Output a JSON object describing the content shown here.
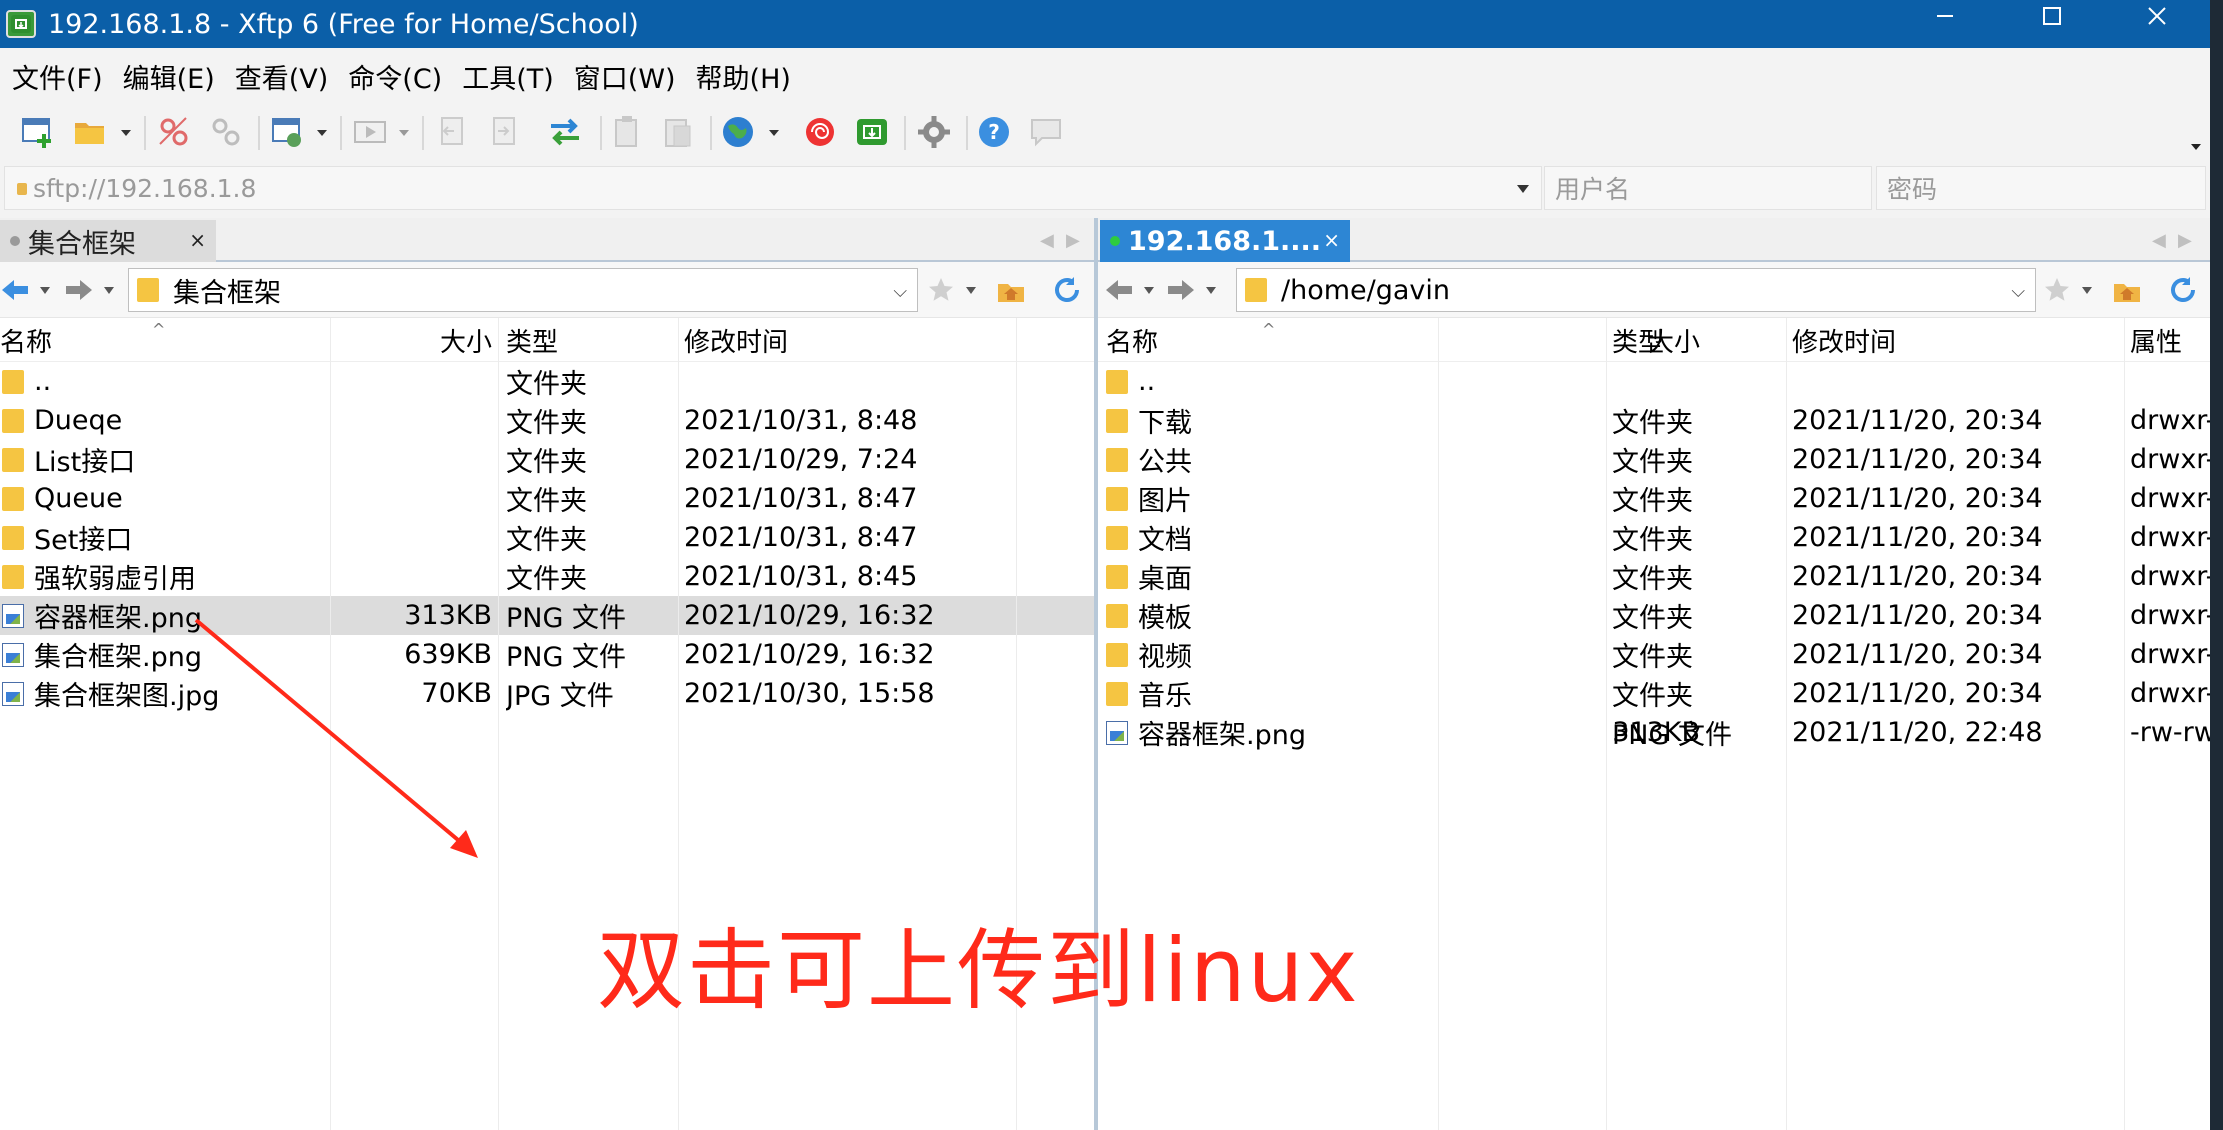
{
  "window": {
    "title": "192.168.1.8 - Xftp 6 (Free for Home/School)",
    "app_icon_label": "🔄"
  },
  "menu": [
    "文件(F)",
    "编辑(E)",
    "查看(V)",
    "命令(C)",
    "工具(T)",
    "窗口(W)",
    "帮助(H)"
  ],
  "toolbar": {
    "icons": [
      "new-session-icon",
      "open-folder-icon",
      "disconnect-icon",
      "reconnect-icon",
      "properties-icon",
      "play-icon",
      "copy-left-icon",
      "copy-right-icon",
      "transfer-icon",
      "paste-icon",
      "paste2-icon",
      "globe-icon",
      "xshell-icon",
      "xftp-icon",
      "gear-icon",
      "help-icon",
      "chat-icon"
    ]
  },
  "address": {
    "value": "sftp://192.168.1.8",
    "user_placeholder": "用户名",
    "password_placeholder": "密码"
  },
  "left_pane": {
    "tab_label": "集合框架",
    "path": "集合框架",
    "columns": [
      "名称",
      "大小",
      "类型",
      "修改时间"
    ],
    "rows": [
      {
        "name": "..",
        "size": "",
        "type": "文件夹",
        "modified": "",
        "icon": "folder"
      },
      {
        "name": "Dueqe",
        "size": "",
        "type": "文件夹",
        "modified": "2021/10/31, 8:48",
        "icon": "folder"
      },
      {
        "name": "List接口",
        "size": "",
        "type": "文件夹",
        "modified": "2021/10/29, 7:24",
        "icon": "folder"
      },
      {
        "name": "Queue",
        "size": "",
        "type": "文件夹",
        "modified": "2021/10/31, 8:47",
        "icon": "folder"
      },
      {
        "name": "Set接口",
        "size": "",
        "type": "文件夹",
        "modified": "2021/10/31, 8:47",
        "icon": "folder"
      },
      {
        "name": "强软弱虚引用",
        "size": "",
        "type": "文件夹",
        "modified": "2021/10/31, 8:45",
        "icon": "folder"
      },
      {
        "name": "容器框架.png",
        "size": "313KB",
        "type": "PNG 文件",
        "modified": "2021/10/29, 16:32",
        "icon": "image",
        "selected": true
      },
      {
        "name": "集合框架.png",
        "size": "639KB",
        "type": "PNG 文件",
        "modified": "2021/10/29, 16:32",
        "icon": "image"
      },
      {
        "name": "集合框架图.jpg",
        "size": "70KB",
        "type": "JPG 文件",
        "modified": "2021/10/30, 15:58",
        "icon": "image"
      }
    ]
  },
  "right_pane": {
    "tab_label": "192.168.1....",
    "path": "/home/gavin",
    "columns": [
      "名称",
      "大小",
      "类型",
      "修改时间",
      "属性"
    ],
    "rows": [
      {
        "name": "..",
        "size": "",
        "type": "",
        "modified": "",
        "attr": "",
        "icon": "folder"
      },
      {
        "name": "下载",
        "size": "",
        "type": "文件夹",
        "modified": "2021/11/20, 20:34",
        "attr": "drwxr-",
        "icon": "folder"
      },
      {
        "name": "公共",
        "size": "",
        "type": "文件夹",
        "modified": "2021/11/20, 20:34",
        "attr": "drwxr-",
        "icon": "folder"
      },
      {
        "name": "图片",
        "size": "",
        "type": "文件夹",
        "modified": "2021/11/20, 20:34",
        "attr": "drwxr-",
        "icon": "folder"
      },
      {
        "name": "文档",
        "size": "",
        "type": "文件夹",
        "modified": "2021/11/20, 20:34",
        "attr": "drwxr-",
        "icon": "folder"
      },
      {
        "name": "桌面",
        "size": "",
        "type": "文件夹",
        "modified": "2021/11/20, 20:34",
        "attr": "drwxr-",
        "icon": "folder"
      },
      {
        "name": "模板",
        "size": "",
        "type": "文件夹",
        "modified": "2021/11/20, 20:34",
        "attr": "drwxr-",
        "icon": "folder"
      },
      {
        "name": "视频",
        "size": "",
        "type": "文件夹",
        "modified": "2021/11/20, 20:34",
        "attr": "drwxr-",
        "icon": "folder"
      },
      {
        "name": "音乐",
        "size": "",
        "type": "文件夹",
        "modified": "2021/11/20, 20:34",
        "attr": "drwxr-",
        "icon": "folder"
      },
      {
        "name": "容器框架.png",
        "size": "313KB",
        "type": "PNG 文件",
        "modified": "2021/11/20, 22:48",
        "attr": "-rw-rw",
        "icon": "image"
      }
    ]
  },
  "annotation": {
    "text": "双击可上传到linux",
    "color": "#ff2a1a"
  },
  "colors": {
    "titlebar": "#0b5fa8",
    "active_tab": "#2d86d4",
    "folder": "#f5c542",
    "selected_row": "#dcdcdc",
    "connected_dot": "#2ecc40"
  }
}
